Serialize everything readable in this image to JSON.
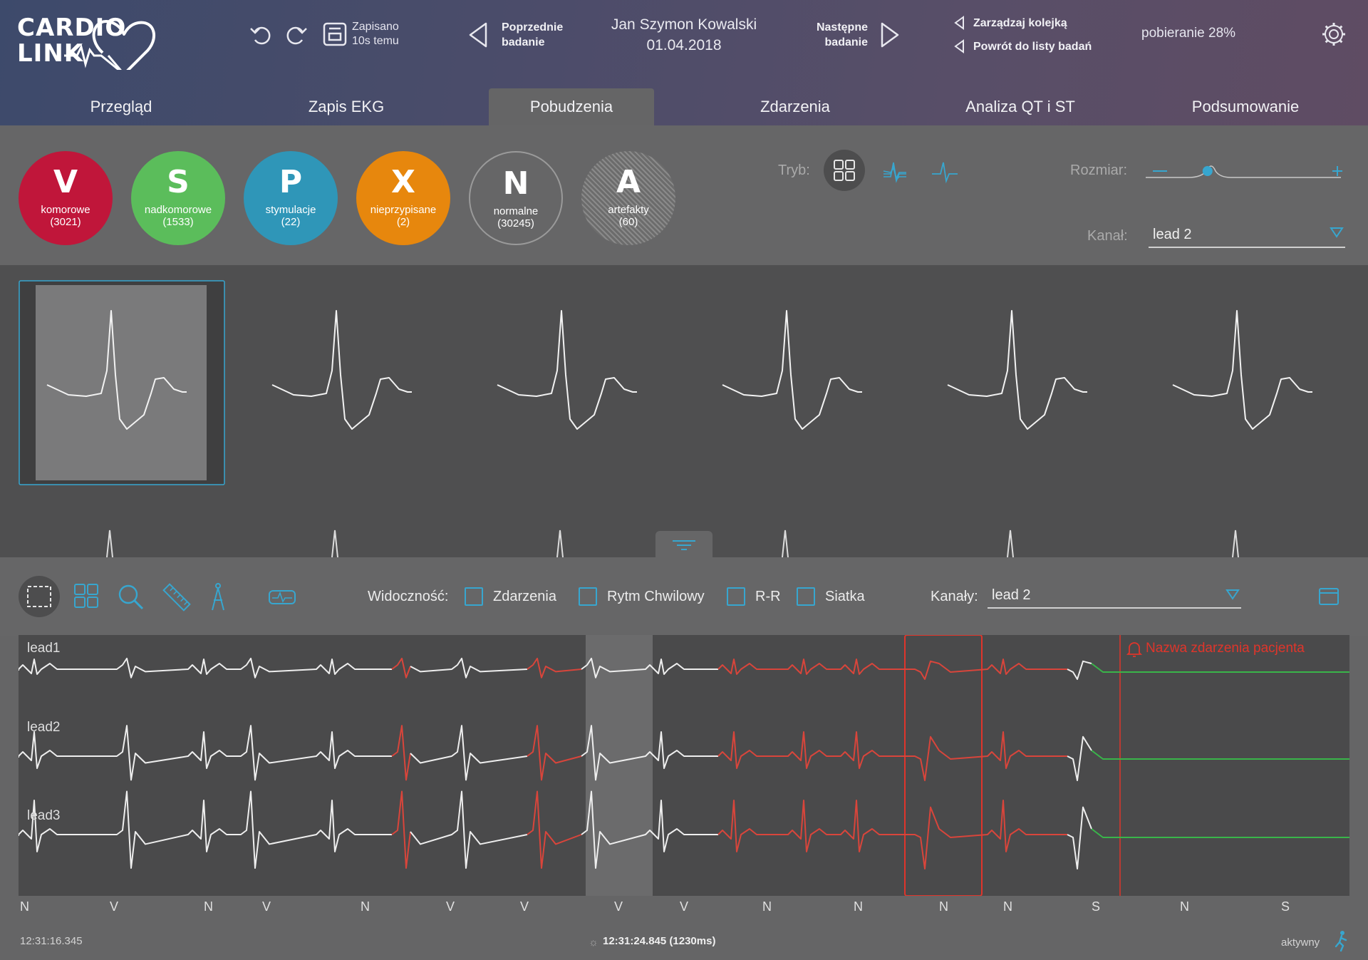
{
  "app": {
    "logo_line1": "CARDIO",
    "logo_line2": "LINK"
  },
  "header": {
    "saved_label": "Zapisano",
    "saved_time": "10s temu",
    "prev_line1": "Poprzednie",
    "prev_line2": "badanie",
    "patient_name": "Jan Szymon Kowalski",
    "exam_date": "01.04.2018",
    "next_line1": "Następne",
    "next_line2": "badanie",
    "manage_queue": "Zarządzaj kolejką",
    "back_to_list": "Powrót do listy badań",
    "download_status": "pobieranie 28%"
  },
  "tabs": [
    {
      "label": "Przegląd"
    },
    {
      "label": "Zapis EKG"
    },
    {
      "label": "Pobudzenia",
      "active": true
    },
    {
      "label": "Zdarzenia"
    },
    {
      "label": "Analiza QT i ST"
    },
    {
      "label": "Podsumowanie"
    }
  ],
  "beat_classes": [
    {
      "letter": "V",
      "label": "komorowe",
      "count": "(3021)",
      "color": "#c0163a"
    },
    {
      "letter": "S",
      "label": "nadkomorowe",
      "count": "(1533)",
      "color": "#5bbd5b"
    },
    {
      "letter": "P",
      "label": "stymulacje",
      "count": "(22)",
      "color": "#2f96b8"
    },
    {
      "letter": "X",
      "label": "nieprzypisane",
      "count": "(2)",
      "color": "#e7870d"
    },
    {
      "letter": "N",
      "label": "normalne",
      "count": "(30245)",
      "color": "#666667"
    },
    {
      "letter": "A",
      "label": "artefakty",
      "count": "(60)",
      "color": "#7a7a7a"
    }
  ],
  "mode": {
    "label": "Tryb:"
  },
  "size": {
    "label": "Rozmiar:",
    "value": 0.32
  },
  "channel": {
    "label": "Kanał:",
    "value": "lead 2"
  },
  "visibility": {
    "label": "Widoczność:",
    "options": [
      "Zdarzenia",
      "Rytm Chwilowy",
      "R-R",
      "Siatka"
    ]
  },
  "channels": {
    "label": "Kanały:",
    "value": "lead 2"
  },
  "leads": [
    "lead1",
    "lead2",
    "lead3"
  ],
  "event_name": "Nazwa zdarzenia pacjenta",
  "beat_codes": [
    "N",
    "V",
    "N",
    "V",
    "N",
    "V",
    "V",
    "V",
    "V",
    "N",
    "N",
    "N",
    "N",
    "S",
    "N",
    "S"
  ],
  "footer": {
    "start_time": "12:31:16.345",
    "cursor_time": "12:31:24.845 (1230ms)",
    "status": "aktywny"
  },
  "colors": {
    "accent": "#37a6cf",
    "event_red": "#e0352b",
    "supra_green": "#39b54a"
  }
}
